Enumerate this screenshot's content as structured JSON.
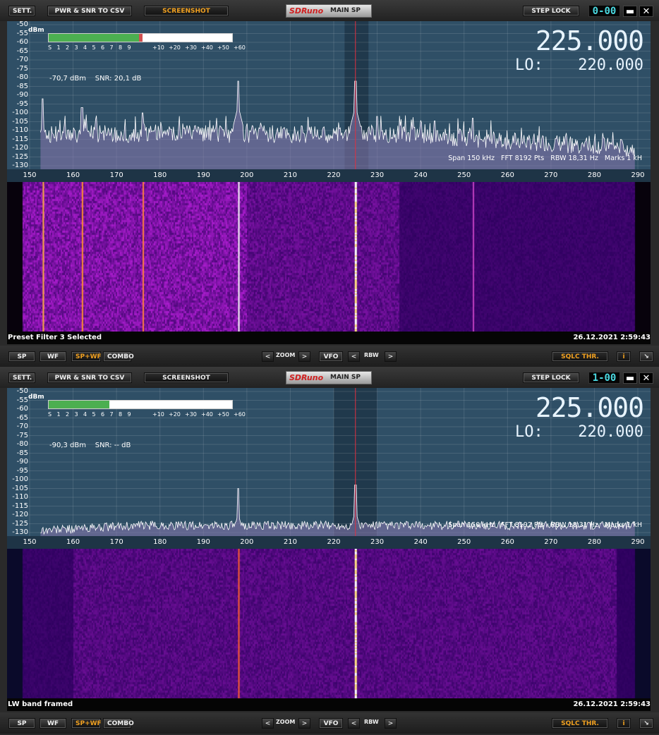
{
  "panels": [
    {
      "toolbar": {
        "sett": "SETT.",
        "pwr_snr": "PWR & SNR TO CSV",
        "screenshot": "SCREENSHOT",
        "logo": "SDRuno",
        "main_sp": "MAIN SP",
        "step_lock": "STEP LOCK",
        "lcd": "0-00",
        "minimize": "▬",
        "close": "✕"
      },
      "spectrum": {
        "dbm_unit": "dBm",
        "y_labels": [
          "-50",
          "-55",
          "-60",
          "-65",
          "-70",
          "-75",
          "-80",
          "-85",
          "-90",
          "-95",
          "-100",
          "-105",
          "-110",
          "-115",
          "-120",
          "-125",
          "-130"
        ],
        "s_scale": [
          "S",
          "1",
          "2",
          "3",
          "4",
          "5",
          "6",
          "7",
          "8",
          "9",
          "+10",
          "+20",
          "+30",
          "+40",
          "+50",
          "+60"
        ],
        "s_level": 0.5,
        "s_peak": 0.51,
        "readout": "-70,7 dBm    SNR: 20,1 dB",
        "frequency": "225.000",
        "lo_label": "LO:",
        "lo_value": "220.000",
        "info": "Span 150 kHz   FFT 8192 Pts   RBW 18,31 Hz   Marks 1 kH",
        "x_labels": [
          "150",
          "160",
          "170",
          "180",
          "190",
          "200",
          "210",
          "220",
          "230",
          "240",
          "250",
          "260",
          "270",
          "280",
          "290"
        ],
        "noise_floor": -112,
        "strong": true
      },
      "status": {
        "left": "Preset Filter 3 Selected",
        "right": "26.12.2021 2:59:43"
      },
      "bottom": {
        "sp": "SP",
        "wf": "WF",
        "spwf": "SP+WF",
        "combo": "COMBO",
        "zoom": "ZOOM",
        "vfo": "VFO",
        "rbw": "RBW",
        "sqlc": "SQLC THR.",
        "info_btn": "i",
        "resize": "↘",
        "prev": "<",
        "next": ">"
      }
    },
    {
      "toolbar": {
        "sett": "SETT.",
        "pwr_snr": "PWR & SNR TO CSV",
        "screenshot": "SCREENSHOT",
        "logo": "SDRuno",
        "main_sp": "MAIN SP",
        "step_lock": "STEP LOCK",
        "lcd": "1-00",
        "minimize": "▬",
        "close": "✕"
      },
      "spectrum": {
        "dbm_unit": "dBm",
        "y_labels": [
          "-50",
          "-55",
          "-60",
          "-65",
          "-70",
          "-75",
          "-80",
          "-85",
          "-90",
          "-95",
          "-100",
          "-105",
          "-110",
          "-115",
          "-120",
          "-125",
          "-130"
        ],
        "s_scale": [
          "S",
          "1",
          "2",
          "3",
          "4",
          "5",
          "6",
          "7",
          "8",
          "9",
          "+10",
          "+20",
          "+30",
          "+40",
          "+50",
          "+60"
        ],
        "s_level": 0.33,
        "s_peak": 0,
        "readout": "-90,3 dBm    SNR: -- dB",
        "frequency": "225.000",
        "lo_label": "LO:",
        "lo_value": "220.000",
        "info": "Span 150 kHz   FFT 8192 Pts   RBW 18,31 Hz   Marks 1 kH",
        "x_labels": [
          "150",
          "160",
          "170",
          "180",
          "190",
          "200",
          "210",
          "220",
          "230",
          "240",
          "250",
          "260",
          "270",
          "280",
          "290"
        ],
        "noise_floor": -126,
        "strong": false
      },
      "status": {
        "left": "LW band framed",
        "right": "26.12.2021 2:59:43"
      },
      "bottom": {
        "sp": "SP",
        "wf": "WF",
        "spwf": "SP+WF",
        "combo": "COMBO",
        "zoom": "ZOOM",
        "vfo": "VFO",
        "rbw": "RBW",
        "sqlc": "SQLC THR.",
        "info_btn": "i",
        "resize": "↘",
        "prev": "<",
        "next": ">"
      }
    }
  ],
  "colors": {
    "spectrum_bg": "#2f4f66",
    "trace": "#ffffff",
    "fill": "#8a7ab0",
    "tuning_line": "#e03040",
    "accent": "#f0a020",
    "lcd": "#4ad8e0"
  },
  "icons": {
    "minimize": "minimize-icon",
    "close": "close-icon",
    "resize": "resize-icon"
  }
}
